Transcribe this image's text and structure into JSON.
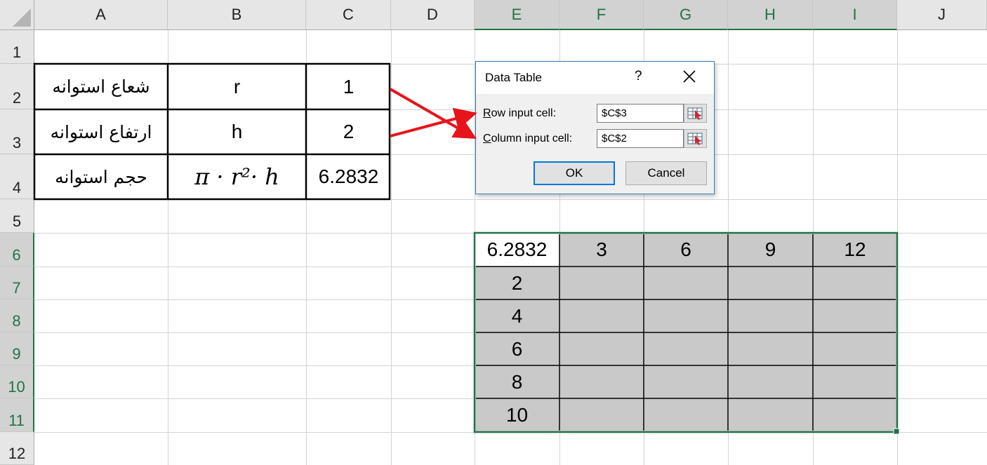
{
  "columns": [
    "A",
    "B",
    "C",
    "D",
    "E",
    "F",
    "G",
    "H",
    "I",
    "J"
  ],
  "rows": [
    "1",
    "2",
    "3",
    "4",
    "5",
    "6",
    "7",
    "8",
    "9",
    "10",
    "11",
    "12"
  ],
  "selected_columns": [
    "E",
    "F",
    "G",
    "H",
    "I"
  ],
  "selected_rows": [
    "6",
    "7",
    "8",
    "9",
    "10",
    "11"
  ],
  "cells": {
    "A2": "شعاع استوانه",
    "B2": "r",
    "C2": "1",
    "A3": "ارتفاع استوانه",
    "B3": "h",
    "C3": "2",
    "A4": "حجم استوانه",
    "B4": "π · r²· h",
    "C4": "6.2832",
    "E6": "6.2832",
    "F6": "3",
    "G6": "6",
    "H6": "9",
    "I6": "12",
    "E7": "2",
    "E8": "4",
    "E9": "6",
    "E10": "8",
    "E11": "10"
  },
  "dialog": {
    "title": "Data Table",
    "help": "?",
    "row_label_key": "R",
    "row_label_rest": "ow input cell:",
    "row_value": "$C$3",
    "col_label_key": "C",
    "col_label_rest": "olumn input cell:",
    "col_value": "$C$2",
    "ok": "OK",
    "cancel": "Cancel"
  },
  "colors": {
    "accent": "#217346",
    "arrow": "#e8141b",
    "shaded": "#c9c9c9",
    "dialog_border": "#3c7fb1"
  },
  "icons": [
    "close-icon",
    "range-selector-icon"
  ]
}
